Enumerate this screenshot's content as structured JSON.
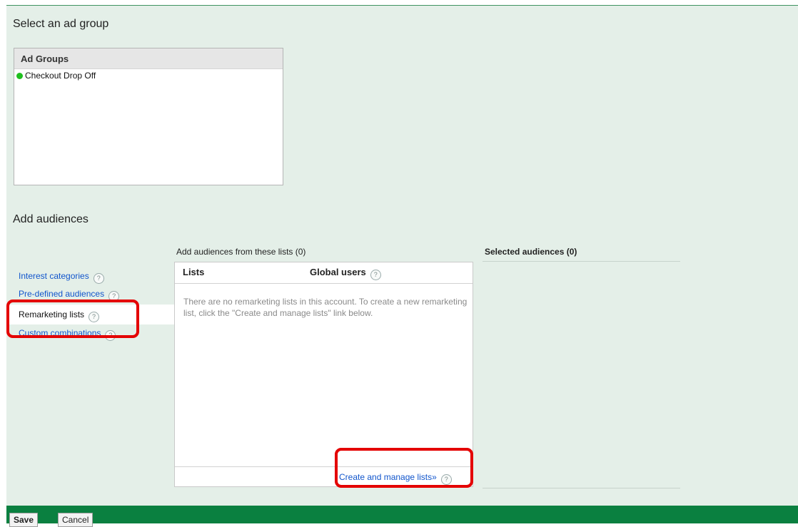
{
  "select_section": {
    "heading": "Select an ad group",
    "ad_groups_header": "Ad Groups",
    "ad_groups": [
      {
        "name": "Checkout Drop Off",
        "status_color": "#1fbf1f"
      }
    ]
  },
  "audiences_section": {
    "heading": "Add audiences",
    "nav": [
      {
        "label": "Interest categories",
        "help": "?"
      },
      {
        "label": "Pre-defined audiences",
        "help": "?"
      },
      {
        "label": "Remarketing lists",
        "help": "?"
      },
      {
        "label": "Custom combinations",
        "help": "?"
      }
    ],
    "lists_caption": "Add audiences from these lists (0)",
    "lists_table": {
      "col_lists": "Lists",
      "col_global_users": "Global users",
      "help": "?",
      "empty_message": "There are no remarketing lists in this account. To create a new remarketing list, click the \"Create and manage lists\" link below.",
      "create_link": "Create and manage lists»"
    },
    "selected_heading": "Selected audiences (0)"
  },
  "footer": {
    "save_label": "Save",
    "cancel_label": "Cancel"
  },
  "colors": {
    "panel_bg": "#e4efe8",
    "footer_bar": "#0a8040",
    "link": "#1155cc",
    "highlight": "#e40000"
  }
}
